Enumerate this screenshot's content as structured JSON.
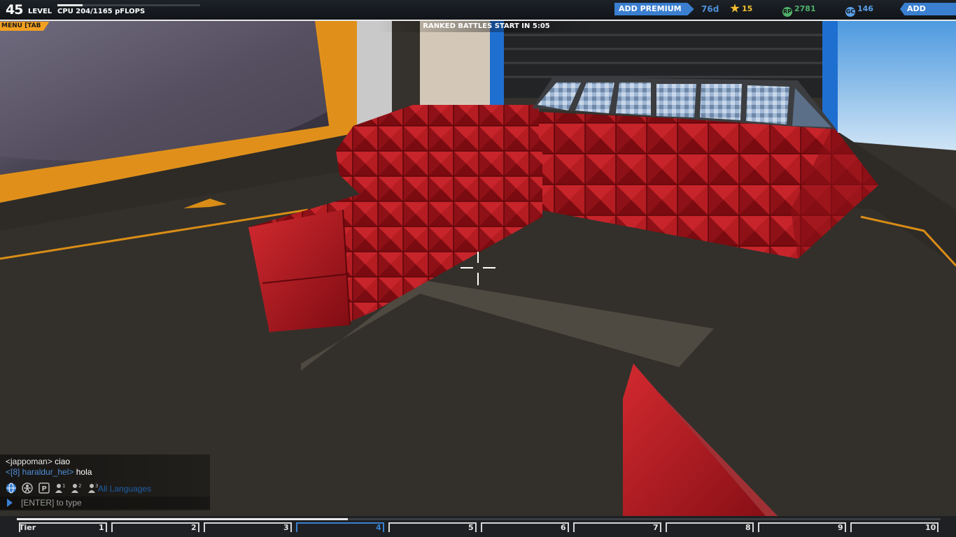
{
  "hud": {
    "level_number": "45",
    "level_label": "LEVEL",
    "cpu_text": "CPU 204/1165 pFLOPS",
    "cpu_fraction": 0.175,
    "add_premium_label": "ADD PREMIUM",
    "premium_days": "76d",
    "stars": "15",
    "rp": "2781",
    "gc": "146",
    "add_funds_label": "ADD FUNDS",
    "menu_tab_label": "MENU [TAB",
    "ranked_text": "RANKED BATTLES START IN 5:05"
  },
  "chat": {
    "line1_user": "<jappoman>",
    "line1_msg": " ciao",
    "line2_user": "<[8] haraldur_hel>",
    "line2_msg": " hola",
    "language_filter": "All Languages",
    "input_placeholder": "[ENTER] to type"
  },
  "tiers": {
    "first_label": "Tier",
    "labels": [
      "1",
      "2",
      "3",
      "4",
      "5",
      "6",
      "7",
      "8",
      "9",
      "10"
    ],
    "active_index": 3,
    "progress_fraction": 0.358
  },
  "colors": {
    "accent_blue": "#3a7fd0",
    "menu_orange": "#f3a020",
    "block_red": "#b3141c"
  }
}
